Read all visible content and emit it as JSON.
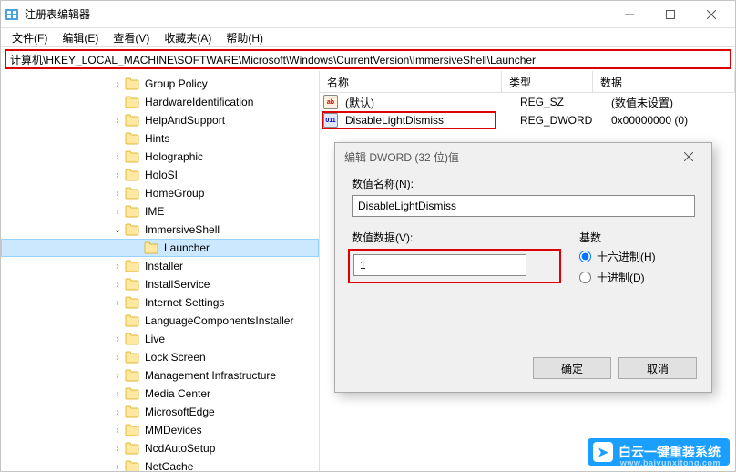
{
  "window": {
    "title": "注册表编辑器"
  },
  "menu": {
    "file": "文件(F)",
    "edit": "编辑(E)",
    "view": "查看(V)",
    "favorites": "收藏夹(A)",
    "help": "帮助(H)"
  },
  "address": "计算机\\HKEY_LOCAL_MACHINE\\SOFTWARE\\Microsoft\\Windows\\CurrentVersion\\ImmersiveShell\\Launcher",
  "tree": [
    {
      "label": "Group Policy",
      "indent": 120,
      "expander": ">"
    },
    {
      "label": "HardwareIdentification",
      "indent": 120,
      "expander": ""
    },
    {
      "label": "HelpAndSupport",
      "indent": 120,
      "expander": ">"
    },
    {
      "label": "Hints",
      "indent": 120,
      "expander": ""
    },
    {
      "label": "Holographic",
      "indent": 120,
      "expander": ">"
    },
    {
      "label": "HoloSI",
      "indent": 120,
      "expander": ">"
    },
    {
      "label": "HomeGroup",
      "indent": 120,
      "expander": ">"
    },
    {
      "label": "IME",
      "indent": 120,
      "expander": ">"
    },
    {
      "label": "ImmersiveShell",
      "indent": 120,
      "expander": "v",
      "open": true
    },
    {
      "label": "Launcher",
      "indent": 140,
      "expander": "",
      "selected": true
    },
    {
      "label": "Installer",
      "indent": 120,
      "expander": ">"
    },
    {
      "label": "InstallService",
      "indent": 120,
      "expander": ">"
    },
    {
      "label": "Internet Settings",
      "indent": 120,
      "expander": ">"
    },
    {
      "label": "LanguageComponentsInstaller",
      "indent": 120,
      "expander": ""
    },
    {
      "label": "Live",
      "indent": 120,
      "expander": ">"
    },
    {
      "label": "Lock Screen",
      "indent": 120,
      "expander": ">"
    },
    {
      "label": "Management Infrastructure",
      "indent": 120,
      "expander": ">"
    },
    {
      "label": "Media Center",
      "indent": 120,
      "expander": ">"
    },
    {
      "label": "MicrosoftEdge",
      "indent": 120,
      "expander": ">"
    },
    {
      "label": "MMDevices",
      "indent": 120,
      "expander": ">"
    },
    {
      "label": "NcdAutoSetup",
      "indent": 120,
      "expander": ">"
    },
    {
      "label": "NetCache",
      "indent": 120,
      "expander": ">"
    }
  ],
  "list": {
    "header": {
      "name": "名称",
      "type": "类型",
      "data": "数据"
    },
    "rows": [
      {
        "iconType": "str",
        "iconText": "ab",
        "name": "(默认)",
        "type": "REG_SZ",
        "data": "(数值未设置)"
      },
      {
        "iconType": "dw",
        "iconText": "011",
        "name": "DisableLightDismiss",
        "type": "REG_DWORD",
        "data": "0x00000000 (0)"
      }
    ]
  },
  "dialog": {
    "title": "编辑 DWORD (32 位)值",
    "nameLabel": "数值名称(N):",
    "nameValue": "DisableLightDismiss",
    "dataLabel": "数值数据(V):",
    "dataValue": "1",
    "baseLabel": "基数",
    "hex": "十六进制(H)",
    "dec": "十进制(D)",
    "ok": "确定",
    "cancel": "取消"
  },
  "watermark": {
    "text": "白云一键重装系统",
    "sub": "www.baiyunxitong.com"
  }
}
